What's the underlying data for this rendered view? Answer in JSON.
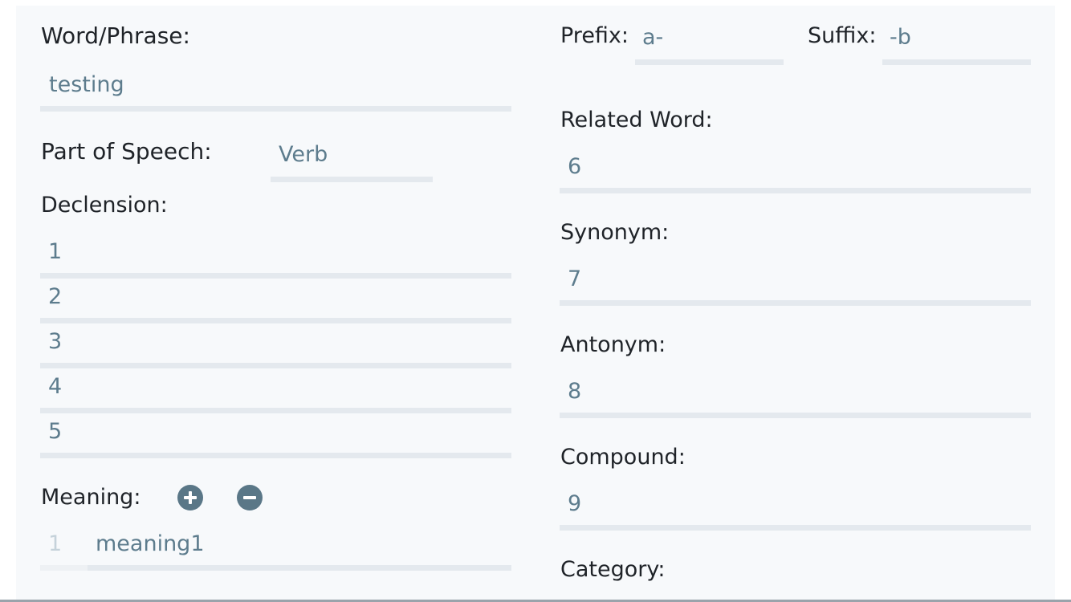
{
  "left": {
    "word_label": "Word/Phrase:",
    "word_value": "testing",
    "pos_label": "Part of Speech:",
    "pos_value": "Verb",
    "declension_label": "Declension:",
    "declensions": [
      "1",
      "2",
      "3",
      "4",
      "5"
    ],
    "meaning_label": "Meaning:",
    "meanings": [
      {
        "index": "1",
        "text": "meaning1"
      }
    ]
  },
  "right": {
    "prefix_label": "Prefix:",
    "prefix_value": "a-",
    "suffix_label": "Suffix:",
    "suffix_value": "-b",
    "related_label": "Related Word:",
    "related_value": "6",
    "synonym_label": "Synonym:",
    "synonym_value": "7",
    "antonym_label": "Antonym:",
    "antonym_value": "8",
    "compound_label": "Compound:",
    "compound_value": "9",
    "category_label": "Category:"
  },
  "icons": {
    "add": "plus-circle-icon",
    "remove": "minus-circle-icon"
  },
  "colors": {
    "panel_bg": "#f7f9fb",
    "label": "#1f2328",
    "value": "#5d7c8d",
    "underline": "#e4e9ee",
    "icon": "#5a7787"
  }
}
